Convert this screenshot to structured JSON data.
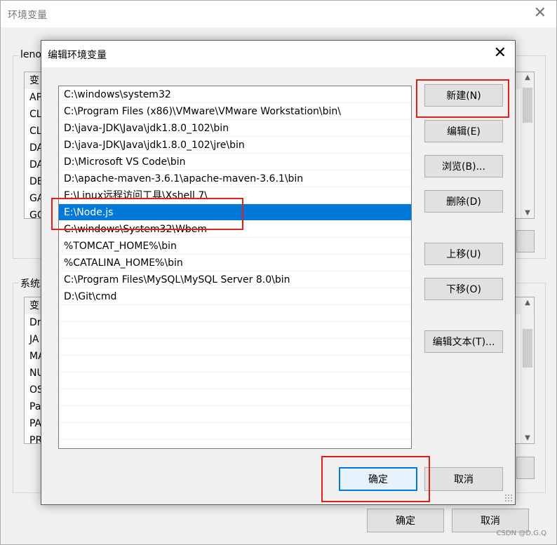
{
  "background": {
    "title": "环境变量",
    "user_group_label": "leno",
    "user_vars_rows": [
      "变",
      "AP",
      "CL",
      "CL",
      "DA",
      "DA",
      "DE",
      "GA",
      "GO"
    ],
    "system_group_label": "系统",
    "system_vars_rows": [
      "变",
      "Dr",
      "JA",
      "MA",
      "NU",
      "OS",
      "Pa",
      "PA",
      "PR"
    ],
    "ok_label": "确定",
    "cancel_label": "取消"
  },
  "dialog": {
    "title": "编辑环境变量",
    "paths": [
      "C:\\windows\\system32",
      "C:\\Program Files (x86)\\VMware\\VMware Workstation\\bin\\",
      "D:\\java-JDK\\Java\\jdk1.8.0_102\\bin",
      "D:\\java-JDK\\Java\\jdk1.8.0_102\\jre\\bin",
      "D:\\Microsoft VS Code\\bin",
      "D:\\apache-maven-3.6.1\\apache-maven-3.6.1\\bin",
      "E:\\Linux远程访问工具\\Xshell 7\\",
      "E:\\Node.js",
      "C:\\windows\\System32\\Wbem",
      "%TOMCAT_HOME%\\bin",
      "%CATALINA_HOME%\\bin",
      "C:\\Program Files\\MySQL\\MySQL Server 8.0\\bin",
      "D:\\Git\\cmd"
    ],
    "selected_index": 7,
    "buttons": {
      "new": "新建(N)",
      "edit": "编辑(E)",
      "browse": "浏览(B)...",
      "delete": "删除(D)",
      "move_up": "上移(U)",
      "move_down": "下移(O)",
      "edit_text": "编辑文本(T)...",
      "ok": "确定",
      "cancel": "取消"
    }
  },
  "watermark": "CSDN @D.G.Q",
  "colors": {
    "selection": "#0078d7",
    "annotation": "#e0201b"
  }
}
